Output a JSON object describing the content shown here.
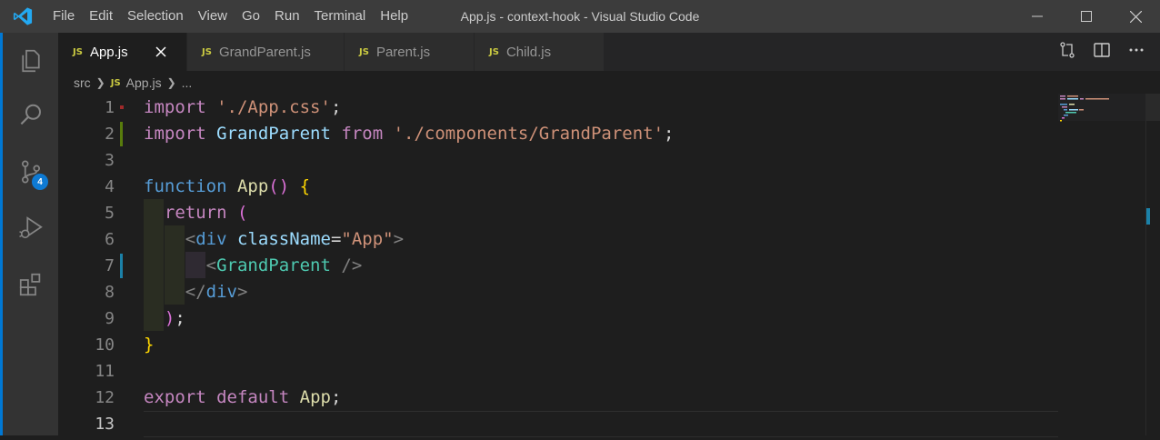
{
  "window": {
    "title": "App.js - context-hook - Visual Studio Code",
    "menu": [
      "File",
      "Edit",
      "Selection",
      "View",
      "Go",
      "Run",
      "Terminal",
      "Help"
    ]
  },
  "activity_bar": {
    "items": [
      "explorer-icon",
      "search-icon",
      "source-control-icon",
      "run-debug-icon",
      "extensions-icon"
    ],
    "source_control_badge": "4"
  },
  "tabs": [
    {
      "badge": "JS",
      "label": "App.js",
      "active": true
    },
    {
      "badge": "JS",
      "label": "GrandParent.js",
      "active": false
    },
    {
      "badge": "JS",
      "label": "Parent.js",
      "active": false
    },
    {
      "badge": "JS",
      "label": "Child.js",
      "active": false
    }
  ],
  "breadcrumb": {
    "folder": "src",
    "file_badge": "JS",
    "file": "App.js",
    "symbol": "..."
  },
  "editor": {
    "lines": [
      {
        "num": "1"
      },
      {
        "num": "2"
      },
      {
        "num": "3"
      },
      {
        "num": "4"
      },
      {
        "num": "5"
      },
      {
        "num": "6"
      },
      {
        "num": "7"
      },
      {
        "num": "8"
      },
      {
        "num": "9"
      },
      {
        "num": "10"
      },
      {
        "num": "11"
      },
      {
        "num": "12"
      },
      {
        "num": "13"
      }
    ],
    "tokens": {
      "l1_import": "import",
      "l1_str": "'./App.css'",
      "l1_semi": ";",
      "l2_import": "import",
      "l2_id": "GrandParent",
      "l2_from": "from",
      "l2_str": "'./components/GrandParent'",
      "l2_semi": ";",
      "l4_function": "function",
      "l4_name": "App",
      "l4_parens": "()",
      "l4_brace": "{",
      "l5_return": "return",
      "l5_paren": "(",
      "l6_open": "<",
      "l6_tag": "div",
      "l6_attr": "className",
      "l6_eq": "=",
      "l6_val": "\"App\"",
      "l6_close": ">",
      "l7_open": "<",
      "l7_comp": "GrandParent",
      "l7_close": "/>",
      "l8_open": "</",
      "l8_tag": "div",
      "l8_close": ">",
      "l9_paren": ")",
      "l9_semi": ";",
      "l10_brace": "}",
      "l12_export": "export",
      "l12_default": "default",
      "l12_id": "App",
      "l12_semi": ";"
    }
  },
  "colors": {
    "accent": "#0078d4",
    "badge": "#0e7ad3",
    "js_badge": "#cbcb41",
    "modified_gutter": "#587c0c",
    "changed_gutter": "#1b81a8"
  }
}
